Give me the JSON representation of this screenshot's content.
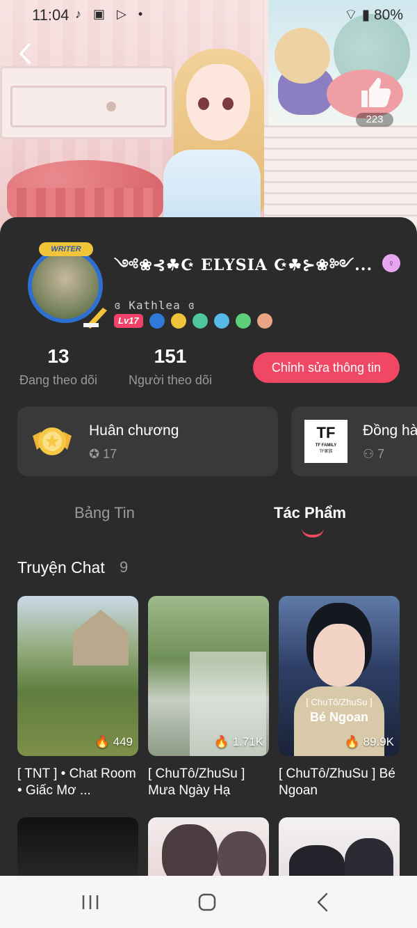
{
  "status_bar": {
    "time": "11:04",
    "left_icons": "♪ ▣ ▷ •",
    "battery": "80%"
  },
  "hero": {
    "like_count": "223"
  },
  "profile": {
    "avatar_badge": "WRITER",
    "display_name": "༺❀⊰☘☪ ELYSIA ☪☘⊱❀༻...",
    "gender_symbol": "♀",
    "username": "ɞ Kathlea ɞ",
    "level": "Lv17",
    "badge_colors": [
      "#2f79d9",
      "#f0c439",
      "#4fc5a0",
      "#57b9e6",
      "#5fd07a",
      "#e8a483"
    ]
  },
  "stats": [
    {
      "value": "13",
      "label": "Đang theo dõi"
    },
    {
      "value": "151",
      "label": "Người theo dõi"
    }
  ],
  "edit_button": "Chỉnh sửa thông tin",
  "cards": {
    "medals": {
      "title": "Huân chương",
      "count": "17"
    },
    "team": {
      "title": "Đồng hà",
      "logo_line1": "TF FAMILY",
      "logo_line2": "TF家族",
      "count": "7"
    }
  },
  "tabs": [
    {
      "label": "Bảng Tin",
      "active": false
    },
    {
      "label": "Tác Phẩm",
      "active": true
    }
  ],
  "section": {
    "title": "Truyện Chat",
    "count": "9"
  },
  "stories": [
    {
      "title": "[ TNT ] • Chat Room • Giấc Mơ ...",
      "stat": "449"
    },
    {
      "title": "[ ChuTô/ZhuSu ] Mưa Ngày Hạ",
      "stat": "1.71K"
    },
    {
      "title": "[ ChuTô/ZhuSu ] Bé Ngoan",
      "stat": "89.9K",
      "cover_caption_top": "[ ChuTô/ZhuSu ]",
      "cover_caption_main": "Bé Ngoan"
    }
  ],
  "colors": {
    "accent": "#f04765",
    "panel_bg": "#2b2b2b",
    "card_bg": "#393939",
    "muted_text": "#9a9a9a"
  }
}
